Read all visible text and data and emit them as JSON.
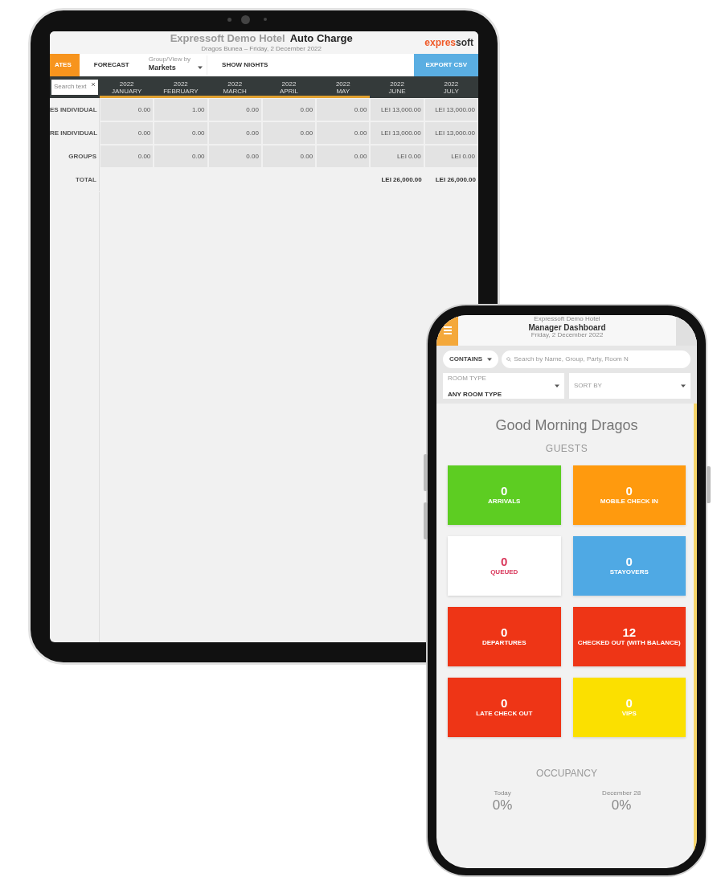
{
  "tablet": {
    "header": {
      "hotel": "Expressoft Demo Hotel",
      "title": "Auto Charge",
      "subtitle": "Dragos Bunea – Friday, 2 December 2022",
      "logo_a": "expres",
      "logo_b": "soft"
    },
    "toolbar": {
      "tabs": [
        {
          "label": "ATES",
          "selected": true
        },
        {
          "label": "FORECAST",
          "selected": false
        }
      ],
      "select": {
        "label": "Group/View by",
        "value": "Markets"
      },
      "toggle": "SHOW NIGHTS",
      "export": "EXPORT CSV"
    },
    "table": {
      "search": {
        "placeholder": "Search text"
      },
      "months": [
        {
          "year": "2022",
          "month": "JANUARY",
          "highlighted": true
        },
        {
          "year": "2022",
          "month": "FEBRUARY",
          "highlighted": true
        },
        {
          "year": "2022",
          "month": "MARCH",
          "highlighted": true
        },
        {
          "year": "2022",
          "month": "APRIL",
          "highlighted": true
        },
        {
          "year": "2022",
          "month": "MAY",
          "highlighted": true
        },
        {
          "year": "2022",
          "month": "JUNE",
          "highlighted": false
        },
        {
          "year": "2022",
          "month": "JULY",
          "highlighted": false
        }
      ],
      "rows": [
        {
          "label": "ES INDIVIDUAL",
          "values": [
            "0.00",
            "1.00",
            "0.00",
            "0.00",
            "0.00",
            "LEI 13,000.00",
            "LEI 13,000.00"
          ]
        },
        {
          "label": "RE INDIVIDUAL",
          "values": [
            "0.00",
            "0.00",
            "0.00",
            "0.00",
            "0.00",
            "LEI 13,000.00",
            "LEI 13,000.00"
          ]
        },
        {
          "label": "GROUPS",
          "values": [
            "0.00",
            "0.00",
            "0.00",
            "0.00",
            "0.00",
            "LEI 0.00",
            "LEI 0.00"
          ]
        }
      ],
      "total": {
        "label": "TOTAL",
        "values": [
          "LEI 26,000.00",
          "LEI 26,000.00"
        ]
      }
    }
  },
  "phone": {
    "header": {
      "hotel": "Expressoft Demo Hotel",
      "title": "Manager Dashboard",
      "subtitle": "Friday, 2 December 2022"
    },
    "search": {
      "mode": "CONTAINS",
      "placeholder": "Search by Name, Group, Party, Room N"
    },
    "filters": [
      {
        "label": "ROOM TYPE",
        "value": "ANY ROOM TYPE"
      },
      {
        "label": "SORT BY"
      }
    ],
    "greeting": "Good Morning Dragos",
    "section": "GUESTS",
    "tiles": [
      {
        "value": "0",
        "label": "ARRIVALS",
        "color": "#5dcd22"
      },
      {
        "value": "0",
        "label": "MOBILE CHECK IN",
        "color": "#ff9a0e"
      },
      {
        "value": "0",
        "label": "QUEUED",
        "color": "#ffffff"
      },
      {
        "value": "0",
        "label": "STAYOVERS",
        "color": "#4fa9e4"
      },
      {
        "value": "0",
        "label": "DEPARTURES",
        "color": "#ee3516"
      },
      {
        "value": "12",
        "label": "CHECKED OUT (WITH BALANCE)",
        "color": "#ee3516"
      },
      {
        "value": "0",
        "label": "LATE CHECK OUT",
        "color": "#ee3516"
      },
      {
        "value": "0",
        "label": "VIPS",
        "color": "#fbe000"
      }
    ],
    "occupancy": {
      "title": "OCCUPANCY",
      "items": [
        {
          "label": "Today",
          "value": "0%"
        },
        {
          "label": "December 28",
          "value": "0%"
        }
      ]
    }
  }
}
